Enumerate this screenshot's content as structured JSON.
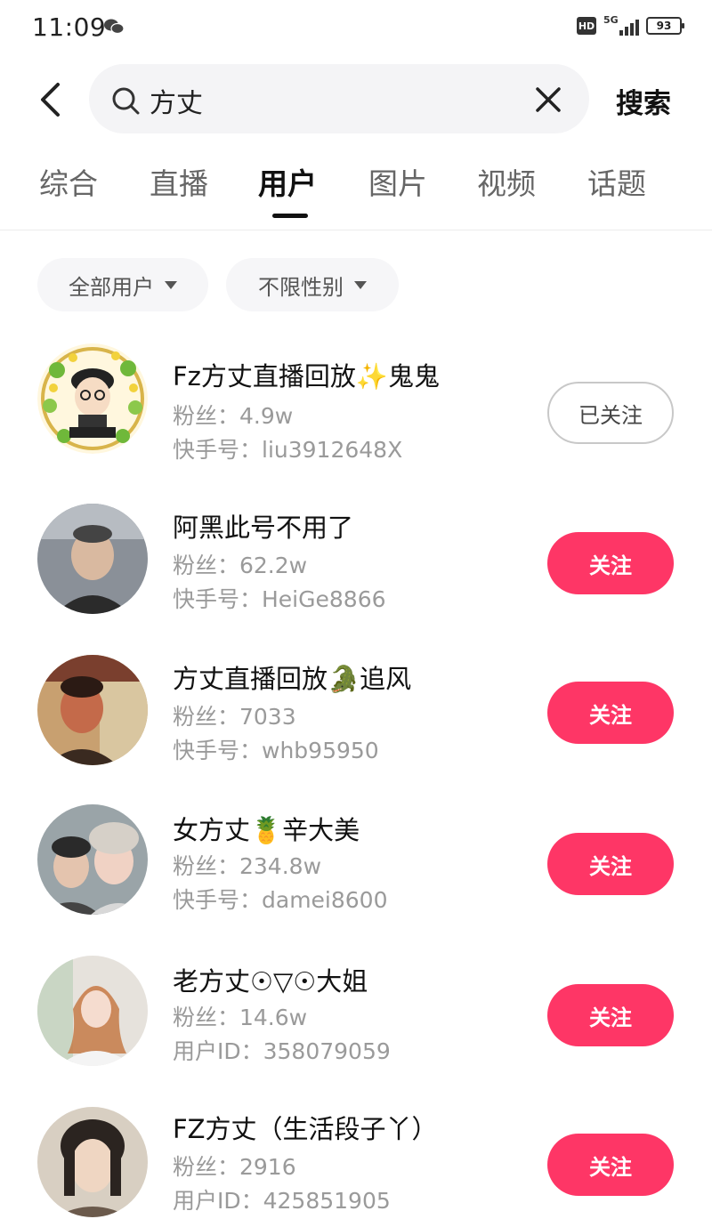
{
  "status_bar": {
    "time": "11:09",
    "network": "5G",
    "hd": "HD",
    "battery": "93"
  },
  "search": {
    "value": "方丈",
    "submit_label": "搜索"
  },
  "tabs": [
    {
      "label": "综合",
      "active": false
    },
    {
      "label": "直播",
      "active": false
    },
    {
      "label": "用户",
      "active": true
    },
    {
      "label": "图片",
      "active": false
    },
    {
      "label": "视频",
      "active": false
    },
    {
      "label": "话题",
      "active": false
    }
  ],
  "filters": [
    {
      "label": "全部用户"
    },
    {
      "label": "不限性别"
    }
  ],
  "users": [
    {
      "name": "Fz方丈直播回放✨鬼鬼",
      "fans": "粉丝：4.9w",
      "account": "快手号：liu3912648X",
      "button": "已关注",
      "following": true
    },
    {
      "name": "阿黑此号不用了",
      "fans": "粉丝：62.2w",
      "account": "快手号：HeiGe8866",
      "button": "关注",
      "following": false
    },
    {
      "name": "方丈直播回放🐊追风",
      "fans": "粉丝：7033",
      "account": "快手号：whb95950",
      "button": "关注",
      "following": false
    },
    {
      "name": "女方丈🍍辛大美",
      "fans": "粉丝：234.8w",
      "account": "快手号：damei8600",
      "button": "关注",
      "following": false
    },
    {
      "name": "老方丈☉▽☉大姐",
      "fans": "粉丝：14.6w",
      "account": "用户ID：358079059",
      "button": "关注",
      "following": false
    },
    {
      "name": "FZ方丈（生活段子丫）",
      "fans": "粉丝：2916",
      "account": "用户ID：425851905",
      "button": "关注",
      "following": false
    }
  ],
  "colors": {
    "accent": "#fe3666",
    "text_primary": "#111111",
    "text_secondary": "#9a9a9a"
  }
}
